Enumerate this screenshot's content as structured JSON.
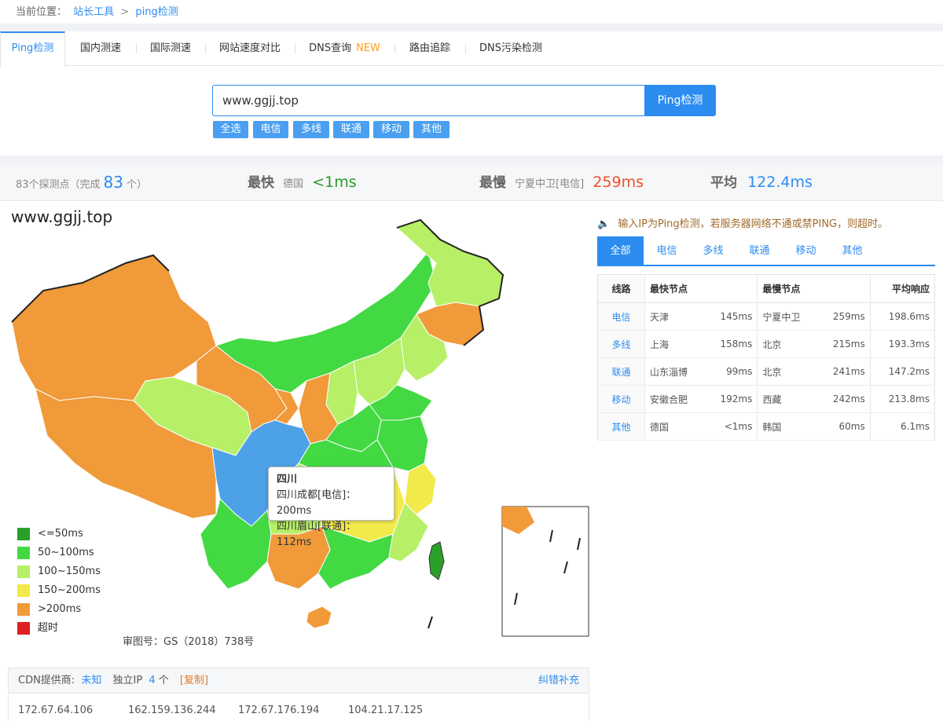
{
  "breadcrumb": {
    "prefix": "当前位置：",
    "item1": "站长工具",
    "sep": ">",
    "item2": "ping检测"
  },
  "tabs": [
    {
      "label": "Ping检测"
    },
    {
      "label": "国内测速"
    },
    {
      "label": "国际测速"
    },
    {
      "label": "网站速度对比"
    },
    {
      "label": "DNS查询",
      "badge": "NEW"
    },
    {
      "label": "路由追踪"
    },
    {
      "label": "DNS污染检测"
    }
  ],
  "search": {
    "value": "www.ggjj.top",
    "button": "Ping检测"
  },
  "chips": [
    "全选",
    "电信",
    "多线",
    "联通",
    "移动",
    "其他"
  ],
  "stats": {
    "points_text": "83个探测点（完成",
    "points_count": "83",
    "points_suffix": "个）",
    "fast_label": "最快",
    "fast_node": "德国",
    "fast_value": "<1ms",
    "slow_label": "最慢",
    "slow_node": "宁夏中卫[电信]",
    "slow_value": "259ms",
    "avg_label": "平均",
    "avg_value": "122.4ms"
  },
  "map": {
    "title": "www.ggjj.top",
    "legend": [
      {
        "label": "<=50ms",
        "color": "#2aa02a"
      },
      {
        "label": "50~100ms",
        "color": "#43d943"
      },
      {
        "label": "100~150ms",
        "color": "#b7f066"
      },
      {
        "label": "150~200ms",
        "color": "#f2e94a"
      },
      {
        "label": ">200ms",
        "color": "#f09a3a"
      },
      {
        "label": "超时",
        "color": "#e02020"
      }
    ],
    "approval": "审图号：GS（2018）738号",
    "tooltip": {
      "title": "四川",
      "line1": "四川成都[电信]：200ms",
      "line2": "四川眉山[联通]：112ms"
    },
    "colors": {
      "far": "#f09a3a",
      "mid": "#b7f066",
      "good": "#43d943",
      "best": "#2aa02a",
      "warn": "#f2e94a",
      "sichuan": "#4da1e6"
    }
  },
  "notice": "输入IP为Ping检测，若服务器网络不通或禁PING，则超时。",
  "filter_tabs": [
    "全部",
    "电信",
    "多线",
    "联通",
    "移动",
    "其他"
  ],
  "table": {
    "headers": [
      "线路",
      "最快节点",
      "最慢节点",
      "平均响应"
    ],
    "rows": [
      {
        "line": "电信",
        "fast_node": "天津",
        "fast_ms": "145ms",
        "slow_node": "宁夏中卫",
        "slow_ms": "259ms",
        "avg": "198.6ms"
      },
      {
        "line": "多线",
        "fast_node": "上海",
        "fast_ms": "158ms",
        "slow_node": "北京",
        "slow_ms": "215ms",
        "avg": "193.3ms"
      },
      {
        "line": "联通",
        "fast_node": "山东淄博",
        "fast_ms": "99ms",
        "slow_node": "北京",
        "slow_ms": "241ms",
        "avg": "147.2ms"
      },
      {
        "line": "移动",
        "fast_node": "安徽合肥",
        "fast_ms": "192ms",
        "slow_node": "西藏",
        "slow_ms": "242ms",
        "avg": "213.8ms"
      },
      {
        "line": "其他",
        "fast_node": "德国",
        "fast_ms": "<1ms",
        "slow_node": "韩国",
        "slow_ms": "60ms",
        "avg": "6.1ms"
      }
    ]
  },
  "cdn": {
    "label": "CDN提供商:",
    "provider": "未知",
    "ip_label": "独立IP",
    "ip_count": "4",
    "ip_unit": "个",
    "copy": "[复制]",
    "report": "纠错补充"
  },
  "ips": [
    "172.67.64.106",
    "162.159.136.244",
    "172.67.176.194",
    "104.21.17.125"
  ]
}
